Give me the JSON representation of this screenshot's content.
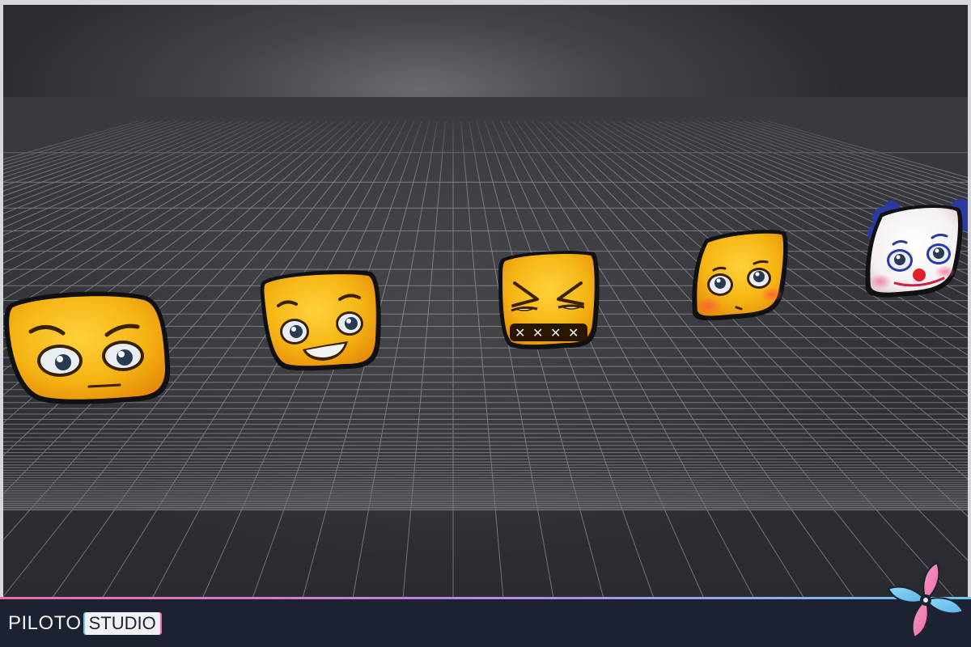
{
  "scene": {
    "emojis": [
      {
        "expression": "skeptical"
      },
      {
        "expression": "grinning"
      },
      {
        "expression": "angry-clenched"
      },
      {
        "expression": "shy-blushing"
      },
      {
        "expression": "clown"
      }
    ]
  },
  "footer": {
    "brand_part1": "PILOTO",
    "brand_part2": "STUDIO"
  },
  "colors": {
    "emoji_yellow": "#f5b514",
    "emoji_orange": "#ec8a0a",
    "grid_line": "#8a8a90",
    "footer_bg": "#1c2232",
    "accent_pink": "#f06ba8",
    "accent_blue": "#6bc6f0"
  },
  "icons": {
    "logo": "pinwheel-icon"
  }
}
